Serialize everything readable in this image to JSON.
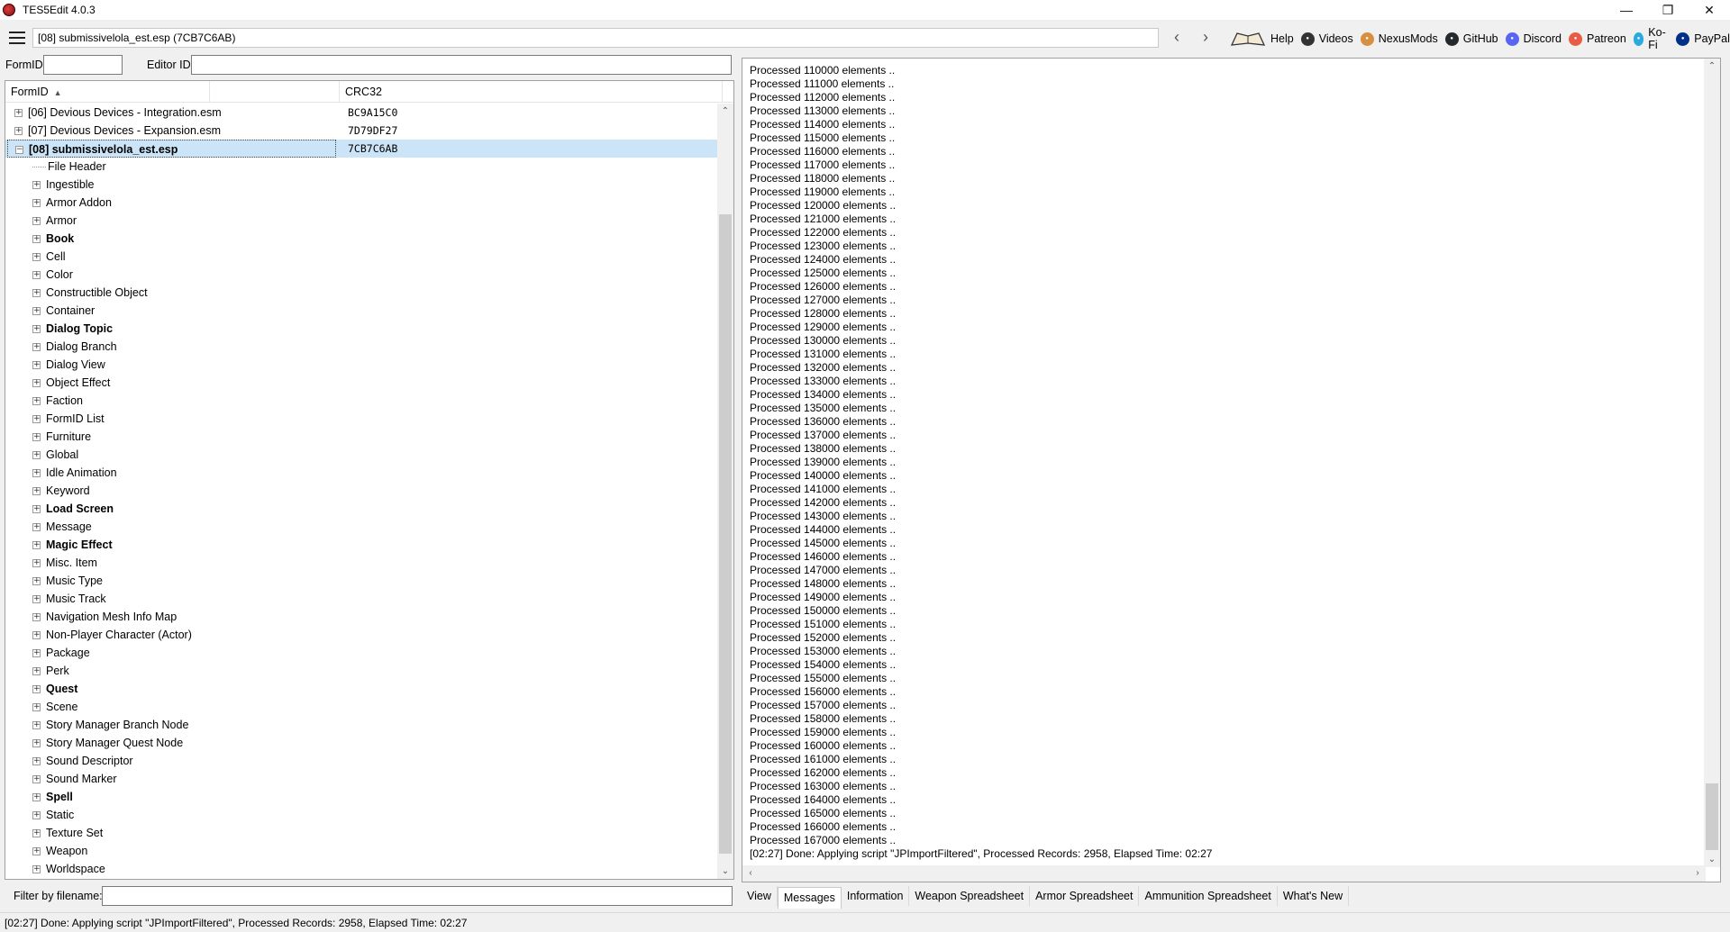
{
  "window": {
    "title": "TES5Edit 4.0.3"
  },
  "toolbar": {
    "path": "[08] submissivelola_est.esp (7CB7C6AB)",
    "links": [
      {
        "label": "Help",
        "icon": "book-icon"
      },
      {
        "label": "Videos",
        "icon": "videos-icon",
        "color": "#333333"
      },
      {
        "label": "NexusMods",
        "icon": "nexusmods-icon",
        "color": "#d98f40"
      },
      {
        "label": "GitHub",
        "icon": "github-icon",
        "color": "#24292e"
      },
      {
        "label": "Discord",
        "icon": "discord-icon",
        "color": "#5865f2"
      },
      {
        "label": "Patreon",
        "icon": "patreon-icon",
        "color": "#e85b46"
      },
      {
        "label": "Ko-Fi",
        "icon": "kofi-icon",
        "color": "#29abe0"
      },
      {
        "label": "PayPal",
        "icon": "paypal-icon",
        "color": "#003087"
      }
    ]
  },
  "search": {
    "formid_label": "FormID",
    "editorid_label": "Editor ID",
    "formid_value": "",
    "editorid_value": ""
  },
  "tree": {
    "columns": {
      "formid": "FormID",
      "crc32": "CRC32"
    },
    "plugins": [
      {
        "label": "[06] Devious Devices - Integration.esm",
        "crc": "BC9A15C0"
      },
      {
        "label": "[07] Devious Devices - Expansion.esm",
        "crc": "7D79DF27"
      },
      {
        "label": "[08] submissivelola_est.esp",
        "crc": "7CB7C6AB"
      }
    ],
    "groups": [
      {
        "label": "File Header",
        "bold": false,
        "expandable": false
      },
      {
        "label": "Ingestible",
        "bold": false,
        "expandable": true
      },
      {
        "label": "Armor Addon",
        "bold": false,
        "expandable": true
      },
      {
        "label": "Armor",
        "bold": false,
        "expandable": true
      },
      {
        "label": "Book",
        "bold": true,
        "expandable": true
      },
      {
        "label": "Cell",
        "bold": false,
        "expandable": true
      },
      {
        "label": "Color",
        "bold": false,
        "expandable": true
      },
      {
        "label": "Constructible Object",
        "bold": false,
        "expandable": true
      },
      {
        "label": "Container",
        "bold": false,
        "expandable": true
      },
      {
        "label": "Dialog Topic",
        "bold": true,
        "expandable": true
      },
      {
        "label": "Dialog Branch",
        "bold": false,
        "expandable": true
      },
      {
        "label": "Dialog View",
        "bold": false,
        "expandable": true
      },
      {
        "label": "Object Effect",
        "bold": false,
        "expandable": true
      },
      {
        "label": "Faction",
        "bold": false,
        "expandable": true
      },
      {
        "label": "FormID List",
        "bold": false,
        "expandable": true
      },
      {
        "label": "Furniture",
        "bold": false,
        "expandable": true
      },
      {
        "label": "Global",
        "bold": false,
        "expandable": true
      },
      {
        "label": "Idle Animation",
        "bold": false,
        "expandable": true
      },
      {
        "label": "Keyword",
        "bold": false,
        "expandable": true
      },
      {
        "label": "Load Screen",
        "bold": true,
        "expandable": true
      },
      {
        "label": "Message",
        "bold": false,
        "expandable": true
      },
      {
        "label": "Magic Effect",
        "bold": true,
        "expandable": true
      },
      {
        "label": "Misc. Item",
        "bold": false,
        "expandable": true
      },
      {
        "label": "Music Type",
        "bold": false,
        "expandable": true
      },
      {
        "label": "Music Track",
        "bold": false,
        "expandable": true
      },
      {
        "label": "Navigation Mesh Info Map",
        "bold": false,
        "expandable": true
      },
      {
        "label": "Non-Player Character (Actor)",
        "bold": false,
        "expandable": true
      },
      {
        "label": "Package",
        "bold": false,
        "expandable": true
      },
      {
        "label": "Perk",
        "bold": false,
        "expandable": true
      },
      {
        "label": "Quest",
        "bold": true,
        "expandable": true
      },
      {
        "label": "Scene",
        "bold": false,
        "expandable": true
      },
      {
        "label": "Story Manager Branch Node",
        "bold": false,
        "expandable": true
      },
      {
        "label": "Story Manager Quest Node",
        "bold": false,
        "expandable": true
      },
      {
        "label": "Sound Descriptor",
        "bold": false,
        "expandable": true
      },
      {
        "label": "Sound Marker",
        "bold": false,
        "expandable": true
      },
      {
        "label": "Spell",
        "bold": true,
        "expandable": true
      },
      {
        "label": "Static",
        "bold": false,
        "expandable": true
      },
      {
        "label": "Texture Set",
        "bold": false,
        "expandable": true
      },
      {
        "label": "Weapon",
        "bold": false,
        "expandable": true
      },
      {
        "label": "Worldspace",
        "bold": false,
        "expandable": true
      }
    ]
  },
  "filter": {
    "label": "Filter by filename:",
    "value": ""
  },
  "log": {
    "lines": [
      "Processed 110000 elements ..",
      "Processed 111000 elements ..",
      "Processed 112000 elements ..",
      "Processed 113000 elements ..",
      "Processed 114000 elements ..",
      "Processed 115000 elements ..",
      "Processed 116000 elements ..",
      "Processed 117000 elements ..",
      "Processed 118000 elements ..",
      "Processed 119000 elements ..",
      "Processed 120000 elements ..",
      "Processed 121000 elements ..",
      "Processed 122000 elements ..",
      "Processed 123000 elements ..",
      "Processed 124000 elements ..",
      "Processed 125000 elements ..",
      "Processed 126000 elements ..",
      "Processed 127000 elements ..",
      "Processed 128000 elements ..",
      "Processed 129000 elements ..",
      "Processed 130000 elements ..",
      "Processed 131000 elements ..",
      "Processed 132000 elements ..",
      "Processed 133000 elements ..",
      "Processed 134000 elements ..",
      "Processed 135000 elements ..",
      "Processed 136000 elements ..",
      "Processed 137000 elements ..",
      "Processed 138000 elements ..",
      "Processed 139000 elements ..",
      "Processed 140000 elements ..",
      "Processed 141000 elements ..",
      "Processed 142000 elements ..",
      "Processed 143000 elements ..",
      "Processed 144000 elements ..",
      "Processed 145000 elements ..",
      "Processed 146000 elements ..",
      "Processed 147000 elements ..",
      "Processed 148000 elements ..",
      "Processed 149000 elements ..",
      "Processed 150000 elements ..",
      "Processed 151000 elements ..",
      "Processed 152000 elements ..",
      "Processed 153000 elements ..",
      "Processed 154000 elements ..",
      "Processed 155000 elements ..",
      "Processed 156000 elements ..",
      "Processed 157000 elements ..",
      "Processed 158000 elements ..",
      "Processed 159000 elements ..",
      "Processed 160000 elements ..",
      "Processed 161000 elements ..",
      "Processed 162000 elements ..",
      "Processed 163000 elements ..",
      "Processed 164000 elements ..",
      "Processed 165000 elements ..",
      "Processed 166000 elements ..",
      "Processed 167000 elements ..",
      "[02:27] Done: Applying script \"JPImportFiltered\", Processed Records: 2958, Elapsed Time: 02:27"
    ]
  },
  "tabs": [
    "View",
    "Messages",
    "Information",
    "Weapon Spreadsheet",
    "Armor Spreadsheet",
    "Ammunition Spreadsheet",
    "What's New"
  ],
  "active_tab": "Messages",
  "status": "[02:27] Done: Applying script \"JPImportFiltered\", Processed Records: 2958, Elapsed Time: 02:27"
}
